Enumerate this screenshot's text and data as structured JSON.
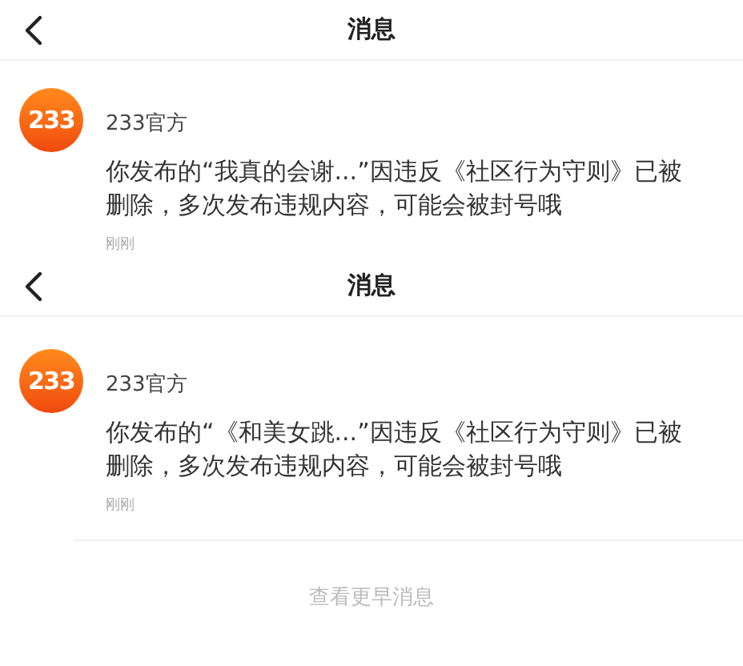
{
  "screens": [
    {
      "title": "消息",
      "messages": [
        {
          "avatar": "233",
          "sender": "233官方",
          "body": "你发布的“我真的会谢...”因违反《社区行为守则》已被删除，多次发布违规内容，可能会被封号哦",
          "time": "刚刚"
        }
      ]
    },
    {
      "title": "消息",
      "messages": [
        {
          "avatar": "233",
          "sender": "233官方",
          "body": "你发布的“《和美女跳...”因违反《社区行为守则》已被删除，多次发布违规内容，可能会被封号哦",
          "time": "刚刚"
        }
      ],
      "footer_link": "查看更早消息"
    }
  ]
}
